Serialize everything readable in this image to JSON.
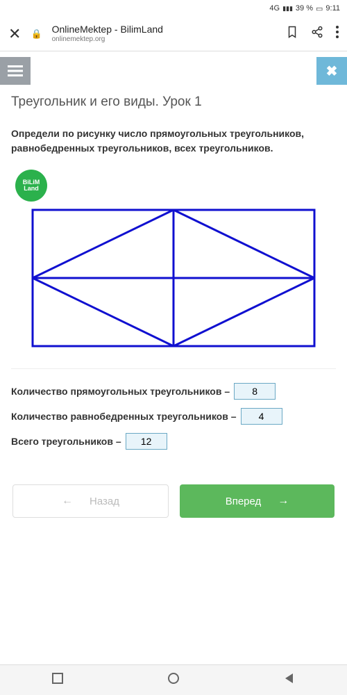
{
  "status": {
    "network": "4G",
    "signal": "▮▮▮",
    "battery": "39 %",
    "battery_icon": "▭",
    "time": "9:11"
  },
  "browser": {
    "title": "OnlineMektep - BilimLand",
    "domain": "onlinemektep.org"
  },
  "logo": {
    "line1": "BiLiM",
    "line2": "Land"
  },
  "lesson": {
    "title": "Треугольник и его виды. Урок 1",
    "question": "Определи по рисунку число прямоугольных треугольников, равнобедренных треугольников, всех треугольников."
  },
  "answers": {
    "row1": {
      "label": "Количество прямоугольных треугольников –",
      "value": "8"
    },
    "row2": {
      "label": "Количество равнобедренных треугольников –",
      "value": "4"
    },
    "row3": {
      "label": "Всего треугольников –",
      "value": "12"
    }
  },
  "nav": {
    "back": "Назад",
    "forward": "Вперед"
  }
}
